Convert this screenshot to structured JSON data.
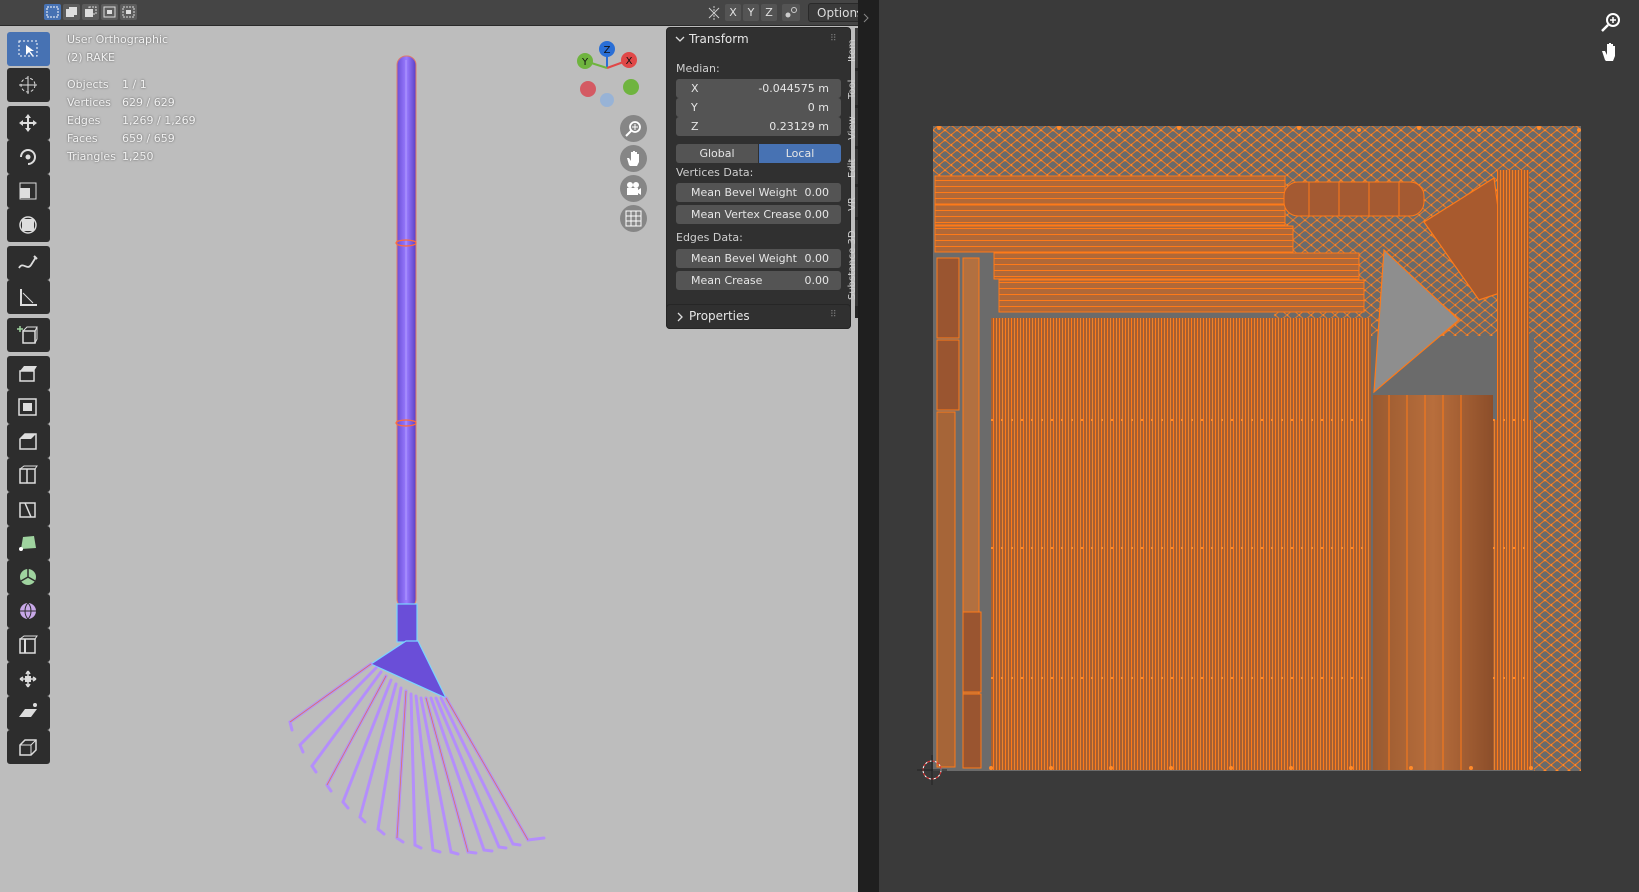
{
  "header3d": {
    "axis_toggles": [
      "X",
      "Y",
      "Z"
    ],
    "options_label": "Options"
  },
  "overlay": {
    "view_name": "User Orthographic",
    "object_name": "(2) RAKE",
    "stats": [
      {
        "label": "Objects",
        "value": "1 / 1"
      },
      {
        "label": "Vertices",
        "value": "629 / 629"
      },
      {
        "label": "Edges",
        "value": "1,269 / 1,269"
      },
      {
        "label": "Faces",
        "value": "659 / 659"
      },
      {
        "label": "Triangles",
        "value": "1,250"
      }
    ]
  },
  "gizmo": {
    "x": "X",
    "y": "Y",
    "z": "Z"
  },
  "transform_panel": {
    "title": "Transform",
    "median_label": "Median:",
    "fields": [
      {
        "label": "X",
        "value": "-0.044575 m"
      },
      {
        "label": "Y",
        "value": "0 m"
      },
      {
        "label": "Z",
        "value": "0.23129 m"
      }
    ],
    "space_options": [
      "Global",
      "Local"
    ],
    "active_space": "Local",
    "vertices_data_label": "Vertices Data:",
    "vertices_fields": [
      {
        "label": "Mean Bevel Weight",
        "value": "0.00"
      },
      {
        "label": "Mean Vertex Crease",
        "value": "0.00"
      }
    ],
    "edges_data_label": "Edges Data:",
    "edges_fields": [
      {
        "label": "Mean Bevel Weight",
        "value": "0.00"
      },
      {
        "label": "Mean Crease",
        "value": "0.00"
      }
    ]
  },
  "properties_panel": {
    "title": "Properties"
  },
  "side_tabs": [
    "Item",
    "Tool",
    "View",
    "Edit",
    "VR",
    "Substance 3D"
  ],
  "colors": {
    "active_blue": "#4772b3",
    "uv_orange": "#ff7a18",
    "mesh_purple": "#7b5cff"
  },
  "icons": {
    "toolbar": [
      "select-box-icon",
      "cursor-icon",
      "move-icon",
      "rotate-icon",
      "scale-icon",
      "transform-icon",
      "annotate-icon",
      "measure-icon",
      "add-cube-icon",
      "extrude-icon",
      "inset-icon",
      "bevel-icon",
      "loop-cut-icon",
      "knife-icon",
      "poly-build-icon",
      "spin-icon",
      "smooth-icon",
      "edge-slide-icon",
      "shrink-fatten-icon",
      "shear-icon",
      "rip-region-icon"
    ]
  }
}
